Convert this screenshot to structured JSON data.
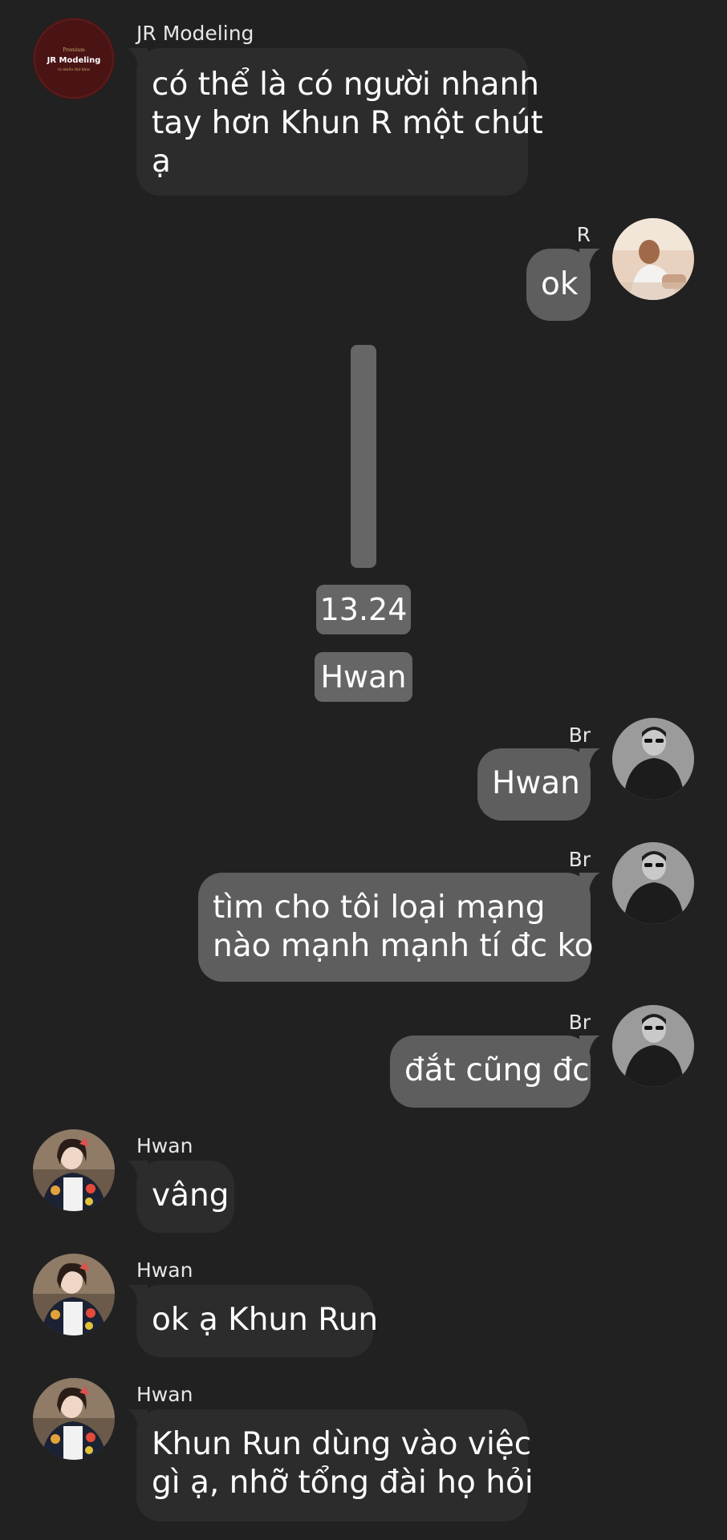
{
  "messages": [
    {
      "sender": "JR Modeling",
      "avatar_lines": [
        "Premium",
        "JR Modeling",
        "và nhiều thứ khác"
      ],
      "lines": [
        "có thể là có người nhanh",
        "tay hơn Khun R một chút",
        "ạ"
      ]
    },
    {
      "sender": "R",
      "lines": [
        "ok"
      ]
    },
    {
      "sender": "Br",
      "lines": [
        "Hwan"
      ]
    },
    {
      "sender": "Br",
      "lines": [
        "tìm cho tôi loại mạng",
        "nào mạnh mạnh tí đc ko"
      ]
    },
    {
      "sender": "Br",
      "lines": [
        "đắt cũng đc"
      ]
    },
    {
      "sender": "Hwan",
      "lines": [
        "vâng"
      ]
    },
    {
      "sender": "Hwan",
      "lines": [
        "ok ạ Khun Run"
      ]
    },
    {
      "sender": "Hwan",
      "lines": [
        "Khun Run dùng vào việc",
        "gì ạ, nhỡ tổng đài họ hỏi"
      ]
    }
  ],
  "system": {
    "time": "13.24",
    "name": "Hwan"
  },
  "colors": {
    "background": "#212121",
    "bubble_incoming": "#2c2c2c",
    "bubble_outgoing": "#5e5e5e",
    "system_pill": "#666666"
  }
}
